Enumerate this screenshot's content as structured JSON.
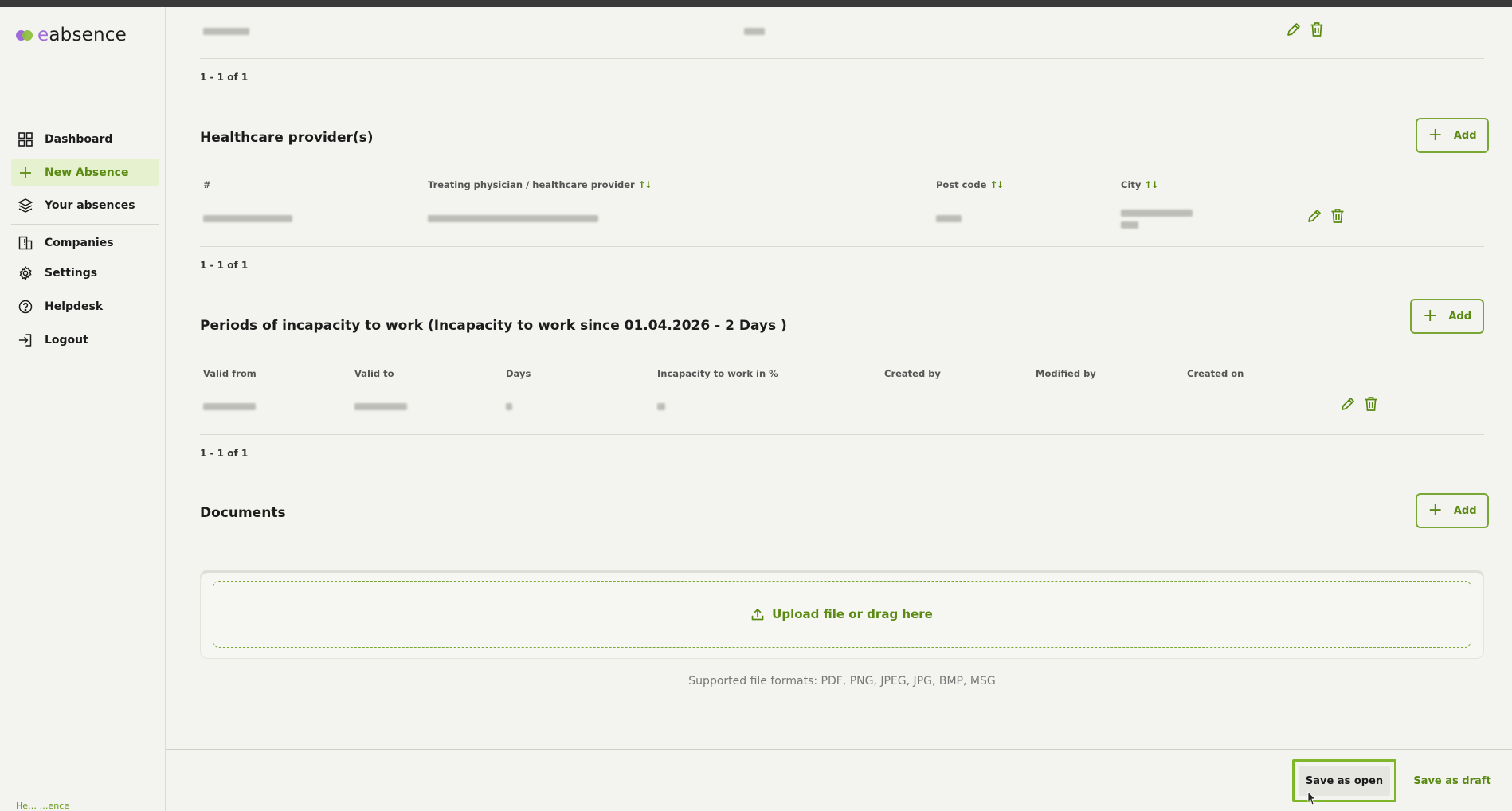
{
  "brand": {
    "logo_text_e": "e",
    "logo_text_rest": "absence",
    "accent": "#7aa635",
    "accent_dark": "#5a8a12",
    "purple": "#9e6bd8"
  },
  "sidebar": {
    "items": [
      {
        "label": "Dashboard",
        "icon": "grid-icon",
        "active": false
      },
      {
        "label": "New Absence",
        "icon": "plus-icon",
        "active": true
      },
      {
        "label": "Your absences",
        "icon": "layers-icon",
        "active": false
      },
      {
        "label": "Companies",
        "icon": "building-icon",
        "active": false
      },
      {
        "label": "Settings",
        "icon": "gear-icon",
        "active": false
      },
      {
        "label": "Helpdesk",
        "icon": "help-circle-icon",
        "active": false
      },
      {
        "label": "Logout",
        "icon": "logout-icon",
        "active": false
      }
    ],
    "footer_text": "He… …ence"
  },
  "top_table": {
    "pager": "1 - 1 of 1"
  },
  "healthcare": {
    "title": "Healthcare provider(s)",
    "add_label": "Add",
    "columns": [
      "#",
      "Treating physician / healthcare provider",
      "Post code",
      "City"
    ],
    "pager": "1 - 1 of 1"
  },
  "periods": {
    "title": "Periods of incapacity to work (Incapacity to work since 01.04.2026 - 2 Days )",
    "add_label": "Add",
    "columns": [
      "Valid from",
      "Valid to",
      "Days",
      "Incapacity to work in %",
      "Created by",
      "Modified by",
      "Created on"
    ],
    "pager": "1 - 1 of 1"
  },
  "documents": {
    "title": "Documents",
    "add_label": "Add",
    "upload_label": "Upload file or drag here",
    "formats": "Supported file formats: PDF, PNG, JPEG, JPG, BMP, MSG"
  },
  "footer": {
    "save_open": "Save as open",
    "save_draft": "Save as draft"
  }
}
